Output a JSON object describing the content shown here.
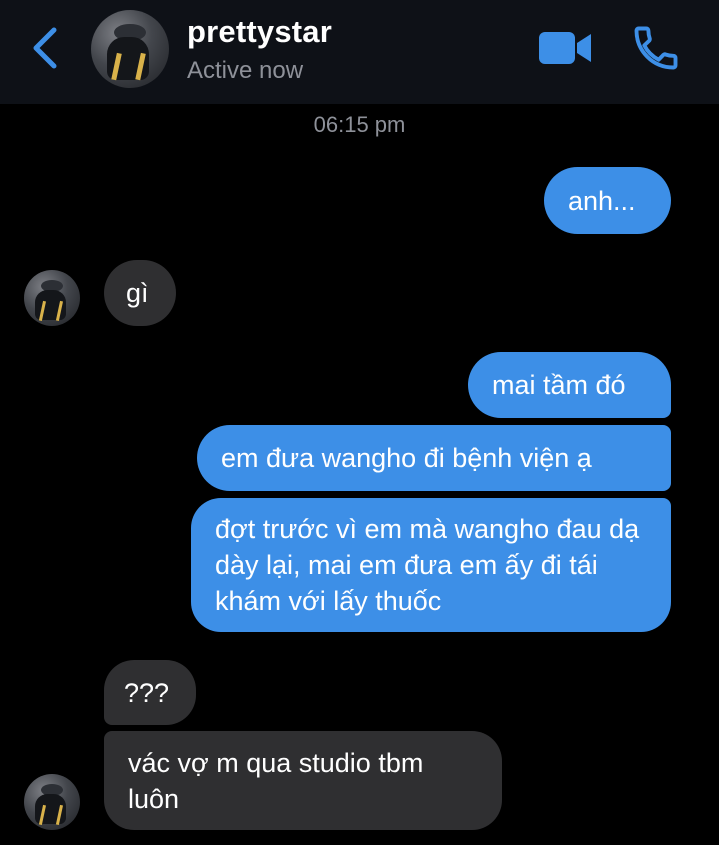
{
  "header": {
    "contact_name": "prettystar",
    "status": "Active now",
    "back_icon": "chevron-left-icon",
    "video_icon": "video-camera-icon",
    "call_icon": "phone-icon",
    "accent_color": "#3d8fe7"
  },
  "conversation": {
    "timestamp": "06:15 pm",
    "messages": [
      {
        "direction": "outgoing",
        "text": "anh..."
      },
      {
        "direction": "incoming",
        "text": "gì"
      },
      {
        "direction": "outgoing",
        "text": "mai tầm đó"
      },
      {
        "direction": "outgoing",
        "text": "em đưa wangho đi bệnh viện ạ"
      },
      {
        "direction": "outgoing",
        "text": "đợt trước vì em mà wangho đau dạ dày lại, mai em đưa em ấy đi tái khám với lấy thuốc"
      },
      {
        "direction": "incoming",
        "text": "???"
      },
      {
        "direction": "incoming",
        "text": "vác vợ m qua studio tbm luôn"
      }
    ]
  },
  "colors": {
    "outgoing_bubble": "#3d8fe7",
    "incoming_bubble": "#2f2f31",
    "background": "#000000"
  }
}
